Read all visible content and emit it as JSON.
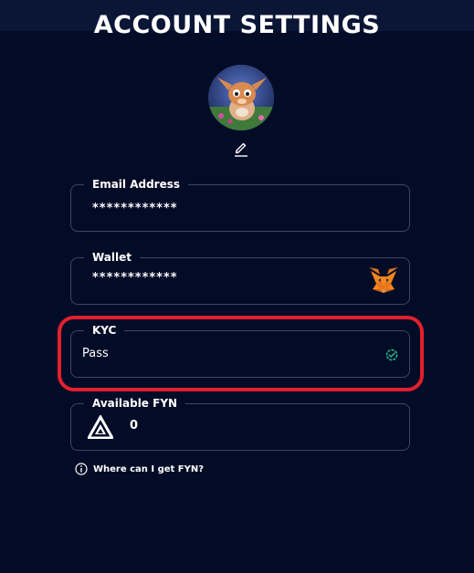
{
  "header": {
    "title": "ACCOUNT SETTINGS"
  },
  "fields": {
    "email": {
      "label": "Email Address",
      "value": "************"
    },
    "wallet": {
      "label": "Wallet",
      "value": "************",
      "icon": "metamask-fox-icon"
    },
    "kyc": {
      "label": "KYC",
      "value": "Pass",
      "icon": "verified-check-icon",
      "status_color": "#27c08a"
    },
    "fyn": {
      "label": "Available FYN",
      "value": "0",
      "icon": "fyn-logo-icon"
    }
  },
  "help": {
    "text": "Where can I get FYN?",
    "icon": "info-icon"
  },
  "colors": {
    "background": "#030c26",
    "border": "#3e4660",
    "highlight": "#e3202e"
  }
}
